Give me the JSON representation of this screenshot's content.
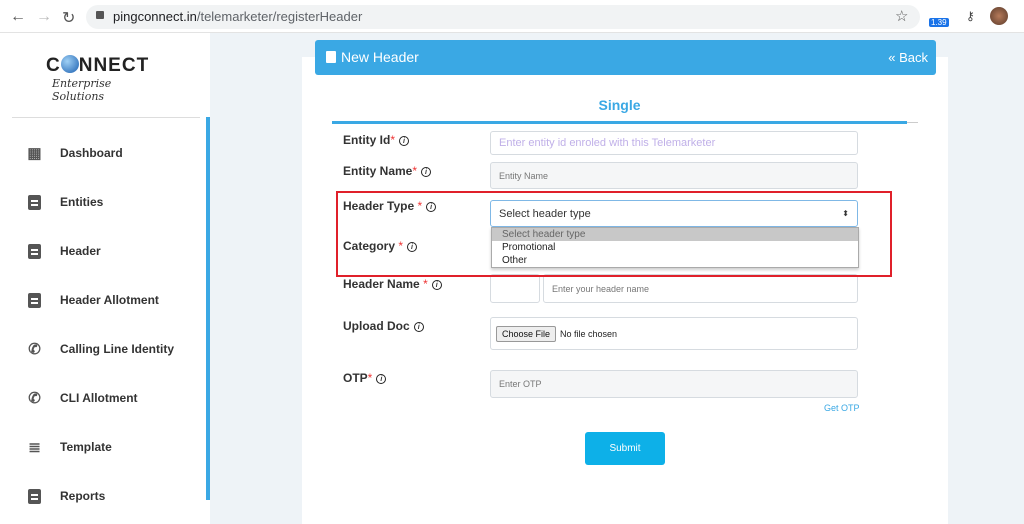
{
  "browser": {
    "url_domain": "pingconnect.in",
    "url_path": "/telemarketer/registerHeader",
    "extension_badge": "1.39"
  },
  "logo": {
    "name": "CONNECT",
    "tagline": "Enterprise Solutions"
  },
  "sidebar": {
    "items": [
      {
        "label": "Dashboard",
        "icon": "dashboard-icon"
      },
      {
        "label": "Entities",
        "icon": "id-badge-icon"
      },
      {
        "label": "Header",
        "icon": "clipboard-icon"
      },
      {
        "label": "Header Allotment",
        "icon": "clipboard-icon"
      },
      {
        "label": "Calling Line Identity",
        "icon": "phone-icon"
      },
      {
        "label": "CLI Allotment",
        "icon": "phone-icon"
      },
      {
        "label": "Template",
        "icon": "list-icon"
      },
      {
        "label": "Reports",
        "icon": "clipboard-icon"
      }
    ]
  },
  "header": {
    "title": "New Header",
    "back": "« Back"
  },
  "tab": "Single",
  "form": {
    "entity_id": {
      "label": "Entity Id",
      "req": "*",
      "placeholder": "Enter entity id enroled with this Telemarketer"
    },
    "entity_name": {
      "label": "Entity Name",
      "req": "*",
      "placeholder": "Entity Name"
    },
    "header_type": {
      "label": "Header Type",
      "req": "*",
      "value": "Select header type",
      "options": [
        "Select header type",
        "Promotional",
        "Other"
      ]
    },
    "category": {
      "label": "Category",
      "req": "*"
    },
    "header_name": {
      "label": "Header Name",
      "req": "*",
      "placeholder": "Enter your header name"
    },
    "upload_doc": {
      "label": "Upload Doc",
      "button": "Choose File",
      "status": "No file chosen"
    },
    "otp": {
      "label": "OTP",
      "req": "*",
      "placeholder": "Enter OTP",
      "get_otp": "Get OTP"
    },
    "submit": "Submit"
  },
  "colors": {
    "accent": "#3aa8e4",
    "submit": "#0db0e8",
    "highlight": "#e0202a"
  }
}
